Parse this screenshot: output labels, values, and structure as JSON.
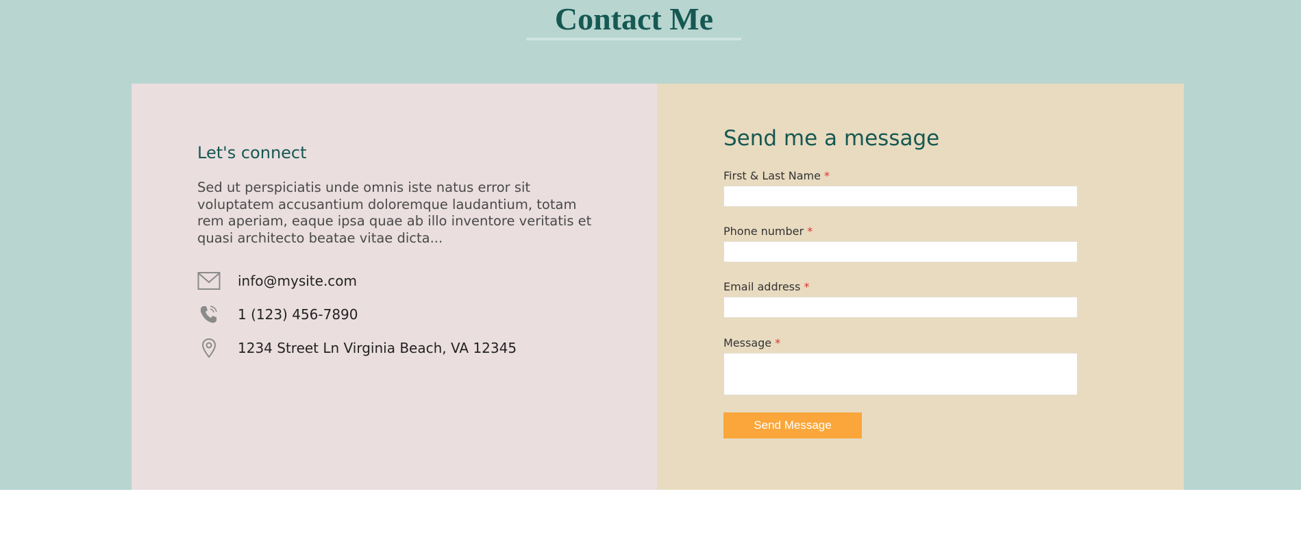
{
  "header": {
    "title": "Contact Me"
  },
  "connect": {
    "heading": "Let's connect",
    "intro": "Sed ut perspiciatis unde omnis iste natus error sit voluptatem accusantium doloremque laudantium, totam rem aperiam, eaque ipsa quae ab illo inventore veritatis et quasi architecto beatae vitae dicta...",
    "email": {
      "icon": "envelope-icon",
      "text": "info@mysite.com"
    },
    "phone": {
      "icon": "phone-icon",
      "text": "1 (123) 456-7890"
    },
    "address": {
      "icon": "location-pin-icon",
      "text": "1234 Street Ln Virginia Beach, VA 12345"
    }
  },
  "form": {
    "heading": "Send me a message",
    "required_marker": "*",
    "fields": [
      {
        "label": "First & Last Name",
        "value": ""
      },
      {
        "label": "Phone number",
        "value": ""
      },
      {
        "label": "Email address",
        "value": ""
      },
      {
        "label": "Message",
        "value": ""
      }
    ],
    "submit_label": "Send Message"
  },
  "colors": {
    "background": "#b8d5d0",
    "accent": "#165852",
    "left_panel": "#eadedf",
    "right_panel": "#e8dbc0",
    "button": "#faa63a",
    "required": "#e03030"
  }
}
